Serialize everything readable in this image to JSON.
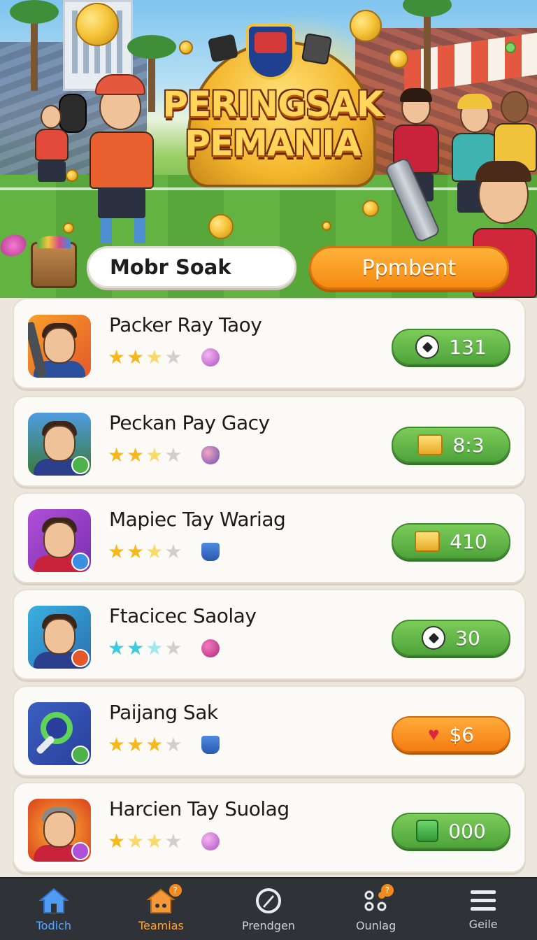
{
  "banner": {
    "title_line1": "PERINGSAK",
    "title_line2": "PEMANIA",
    "search_label": "Mobr Soak",
    "cta_label": "Ppmbent"
  },
  "items": [
    {
      "name": "Packer Ray Taoy",
      "stars": 3,
      "star_color": "#f6b81c",
      "value": "131",
      "button_color": "green",
      "icon": "soccer-ball-icon"
    },
    {
      "name": "Peckan Pay Gacy",
      "stars": 3,
      "star_color": "#f6b81c",
      "value": "8:3",
      "button_color": "green",
      "icon": "gold-bars-icon"
    },
    {
      "name": "Mapiec Tay Wariag",
      "stars": 3,
      "star_color": "#f6b81c",
      "value": "410",
      "button_color": "green",
      "icon": "gold-bars-icon"
    },
    {
      "name": "Ftacicec Saolay",
      "stars": 3,
      "star_color": "#3ecbe0",
      "value": "30",
      "button_color": "green",
      "icon": "soccer-ball-icon"
    },
    {
      "name": "Paijang Sak",
      "stars": 3,
      "star_color": "#f6b81c",
      "value": "$6",
      "button_color": "orange",
      "icon": "heart-icon"
    },
    {
      "name": "Harcien Tay Suolag",
      "stars": 3,
      "star_color": "#f6b81c",
      "value": "000",
      "button_color": "green",
      "icon": "cash-box-icon"
    }
  ],
  "nav": [
    {
      "label": "Todich",
      "icon": "home-icon",
      "active": true
    },
    {
      "label": "Teamias",
      "icon": "team-house-icon",
      "badge": "?"
    },
    {
      "label": "Prendgen",
      "icon": "compass-icon"
    },
    {
      "label": "Ounlag",
      "icon": "dots-icon",
      "badge": "?"
    },
    {
      "label": "Geile",
      "icon": "menu-icon"
    }
  ],
  "colors": {
    "accent_orange": "#f58a12",
    "button_green": "#4ea43a",
    "nav_bg": "#2f3338",
    "card_bg": "#fbfaf7"
  }
}
